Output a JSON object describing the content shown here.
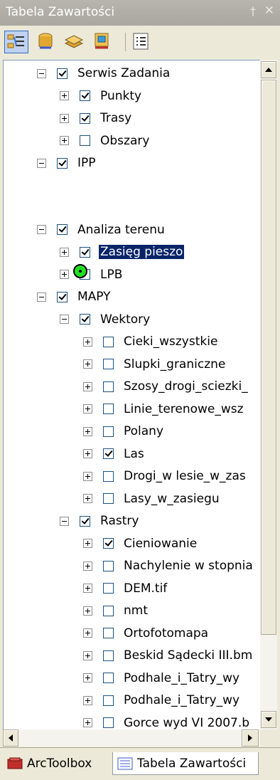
{
  "window": {
    "title": "Tabela Zawartości",
    "pin_glyph": "P",
    "close_glyph": "×"
  },
  "toolbar": {
    "buttons": [
      {
        "icon": "list-by-drawing-order-icon",
        "active": true
      },
      {
        "icon": "list-by-source-icon"
      },
      {
        "icon": "list-by-visibility-icon"
      },
      {
        "icon": "list-by-selection-icon"
      },
      {
        "icon": "options-icon"
      }
    ]
  },
  "tree": {
    "rows": [
      {
        "label": "Serwis Zadania",
        "level": 0,
        "expanded": true,
        "checked": true
      },
      {
        "label": "Punkty",
        "level": 1,
        "expanded": false,
        "checked": true
      },
      {
        "label": "Trasy",
        "level": 1,
        "expanded": false,
        "checked": true
      },
      {
        "label": "Obszary",
        "level": 1,
        "expanded": false,
        "checked": false
      },
      {
        "label": "IPP",
        "level": 0,
        "expanded": true,
        "checked": true
      },
      {
        "label": "Analiza terenu",
        "level": 0,
        "expanded": true,
        "checked": true
      },
      {
        "label": "Zasięg pieszo",
        "level": 1,
        "expanded": false,
        "checked": true,
        "selected": true
      },
      {
        "label": "LPB",
        "level": 1,
        "expanded": false,
        "checked": false
      },
      {
        "label": "MAPY",
        "level": 0,
        "expanded": true,
        "checked": true
      },
      {
        "label": "Wektory",
        "level": 1,
        "expanded": true,
        "checked": true
      },
      {
        "label": "Cieki_wszystkie",
        "level": 2,
        "expanded": false,
        "checked": false
      },
      {
        "label": "Slupki_graniczne",
        "level": 2,
        "expanded": false,
        "checked": false
      },
      {
        "label": "Szosy_drogi_sciezki_",
        "level": 2,
        "expanded": false,
        "checked": false
      },
      {
        "label": "Linie_terenowe_wsz",
        "level": 2,
        "expanded": false,
        "checked": false
      },
      {
        "label": "Polany",
        "level": 2,
        "expanded": false,
        "checked": false
      },
      {
        "label": "Las",
        "level": 2,
        "expanded": false,
        "checked": true
      },
      {
        "label": "Drogi_w lesie_w_zas",
        "level": 2,
        "expanded": false,
        "checked": false
      },
      {
        "label": "Lasy_w_zasiegu",
        "level": 2,
        "expanded": false,
        "checked": false
      },
      {
        "label": "Rastry",
        "level": 1,
        "expanded": true,
        "checked": true
      },
      {
        "label": "Cieniowanie",
        "level": 2,
        "expanded": false,
        "checked": true
      },
      {
        "label": "Nachylenie w stopnia",
        "level": 2,
        "expanded": false,
        "checked": false
      },
      {
        "label": "DEM.tif",
        "level": 2,
        "expanded": false,
        "checked": false
      },
      {
        "label": "nmt",
        "level": 2,
        "expanded": false,
        "checked": false
      },
      {
        "label": "Ortofotomapa",
        "level": 2,
        "expanded": false,
        "checked": false
      },
      {
        "label": "Beskid Sądecki III.bm",
        "level": 2,
        "expanded": false,
        "checked": false
      },
      {
        "label": "Podhale_i_Tatry_wy",
        "level": 2,
        "expanded": false,
        "checked": false
      },
      {
        "label": "Podhale_i_Tatry_wy",
        "level": 2,
        "expanded": false,
        "checked": false
      },
      {
        "label": "Gorce wyd VI 2007.b",
        "level": 2,
        "expanded": false,
        "checked": false
      }
    ],
    "ipp_symbol_color": "#22e022",
    "selection_color": "#0a246a"
  },
  "tabs": [
    {
      "label": "ArcToolbox",
      "icon": "arctoolbox-icon",
      "active": false
    },
    {
      "label": "Tabela Zawartości",
      "icon": "table-of-contents-icon",
      "active": true
    }
  ]
}
